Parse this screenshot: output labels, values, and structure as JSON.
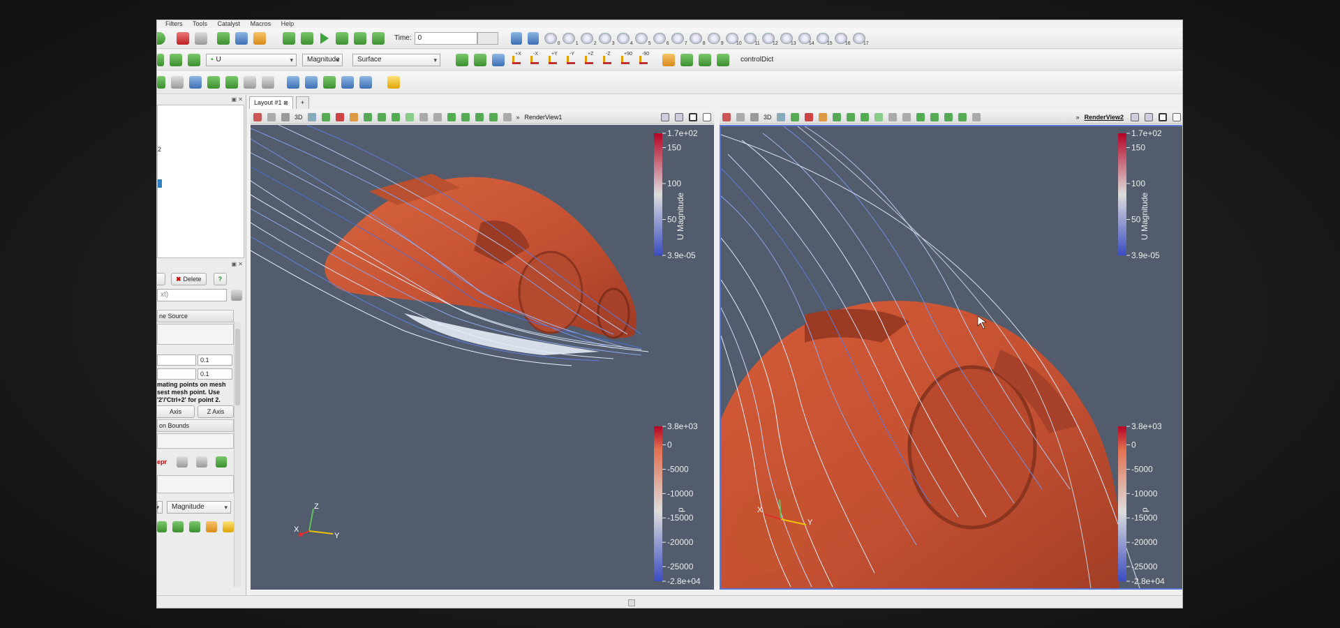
{
  "menu": [
    "Filters",
    "Tools",
    "Catalyst",
    "Macros",
    "Help"
  ],
  "toolbar": {
    "time_label": "Time:",
    "time_value": "0",
    "camera_indices": [
      "0",
      "1",
      "2",
      "3",
      "4",
      "5",
      "6",
      "7",
      "8",
      "9",
      "10",
      "11",
      "12",
      "13",
      "14",
      "15",
      "16",
      "17"
    ],
    "active_variable": "U",
    "component": "Magnitude",
    "representation": "Surface",
    "axis_buttons": [
      "+X",
      "-X",
      "+Y",
      "-Y",
      "+Z",
      "-Z"
    ],
    "rotate_labels": [
      "+90",
      "-90"
    ],
    "file_label": "controlDict"
  },
  "left_panel": {
    "browser_fragment": "2",
    "delete_label": "Delete",
    "help_label": "?",
    "search_fragment": "xt)",
    "section_source": "ne Source",
    "value_1": "0.1",
    "value_2": "0.1",
    "note_lines": [
      "mating points on mesh",
      "sest mesh point. Use",
      "'2'/'Ctrl+2' for point 2."
    ],
    "axis_y_label": "Axis",
    "axis_z_label": "Z Axis",
    "bounds_label": "on Bounds",
    "repr_fragment": "epr",
    "coloring_component": "Magnitude"
  },
  "layout": {
    "tab_label": "Layout #1",
    "add_tab_label": "+",
    "view1_name": "RenderView1",
    "view2_name": "RenderView2",
    "mode_3d": "3D"
  },
  "colorbar_u": {
    "title": "U Magnitude",
    "labels": [
      "1.7e+02",
      "150",
      "100",
      "50",
      "3.9e-05"
    ],
    "values": [
      170,
      150,
      100,
      50,
      3.9e-05
    ],
    "range": [
      3.9e-05,
      170
    ]
  },
  "colorbar_p": {
    "title": "p",
    "labels": [
      "3.8e+03",
      "0",
      "-5000",
      "-10000",
      "-15000",
      "-20000",
      "-25000",
      "-2.8e+04"
    ],
    "values": [
      3800,
      0,
      -5000,
      -10000,
      -15000,
      -20000,
      -25000,
      -28000
    ],
    "range": [
      -28000,
      3800
    ]
  },
  "orientation_axes": {
    "x": "X",
    "y": "Y",
    "z": "Z"
  },
  "colors": {
    "render_bg": "#525c6c",
    "car_surface": "#c8553a",
    "streamline_low": "#4a6fd8",
    "streamline_high": "#e8eef8",
    "active_view_border": "#5a76d8"
  }
}
